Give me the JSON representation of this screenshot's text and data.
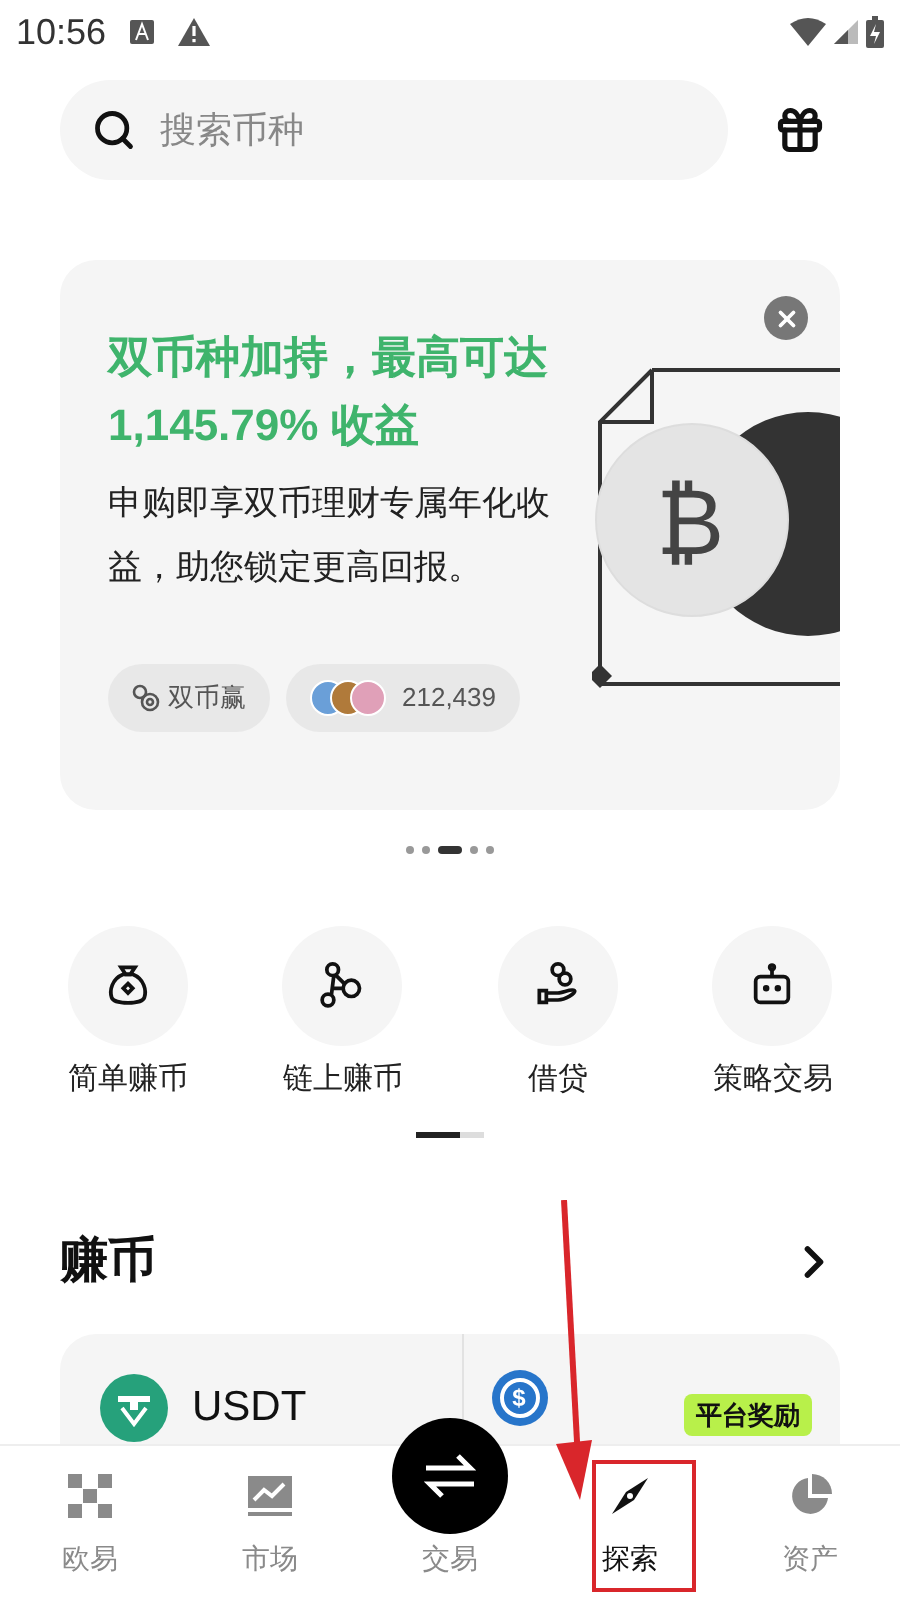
{
  "status_bar": {
    "time": "10:56"
  },
  "search": {
    "placeholder": "搜索币种"
  },
  "banner": {
    "title": "双币种加持，最高可达",
    "highlight": "1,145.79% 收益",
    "description": "申购即享双币理财专属年化收益，助您锁定更高回报。",
    "tag": "双币赢",
    "participants": "212,439",
    "coin_symbol": "₿"
  },
  "banner_dots": [
    {
      "selected": false
    },
    {
      "selected": false
    },
    {
      "selected": true
    },
    {
      "selected": false
    },
    {
      "selected": false
    }
  ],
  "shortcuts": [
    {
      "kind": "bag",
      "label": "简单赚币"
    },
    {
      "kind": "chain",
      "label": "链上赚币"
    },
    {
      "kind": "loan",
      "label": "借贷"
    },
    {
      "kind": "bot",
      "label": "策略交易"
    }
  ],
  "shortcut_pager": [
    {
      "selected": true
    },
    {
      "selected": false
    }
  ],
  "section": {
    "title": "赚币"
  },
  "earn_cards": [
    {
      "kind": "usdt",
      "coin": "USDT"
    },
    {
      "kind": "usdc",
      "symbol": "$",
      "badge": "平台奖励"
    }
  ],
  "nav": [
    {
      "kind": "grid",
      "label": "欧易",
      "selected": false
    },
    {
      "kind": "chart",
      "label": "市场",
      "selected": false
    },
    {
      "kind": "trade",
      "label": "交易",
      "selected": false
    },
    {
      "kind": "compass",
      "label": "探索",
      "selected": true
    },
    {
      "kind": "pie",
      "label": "资产",
      "selected": false
    }
  ]
}
